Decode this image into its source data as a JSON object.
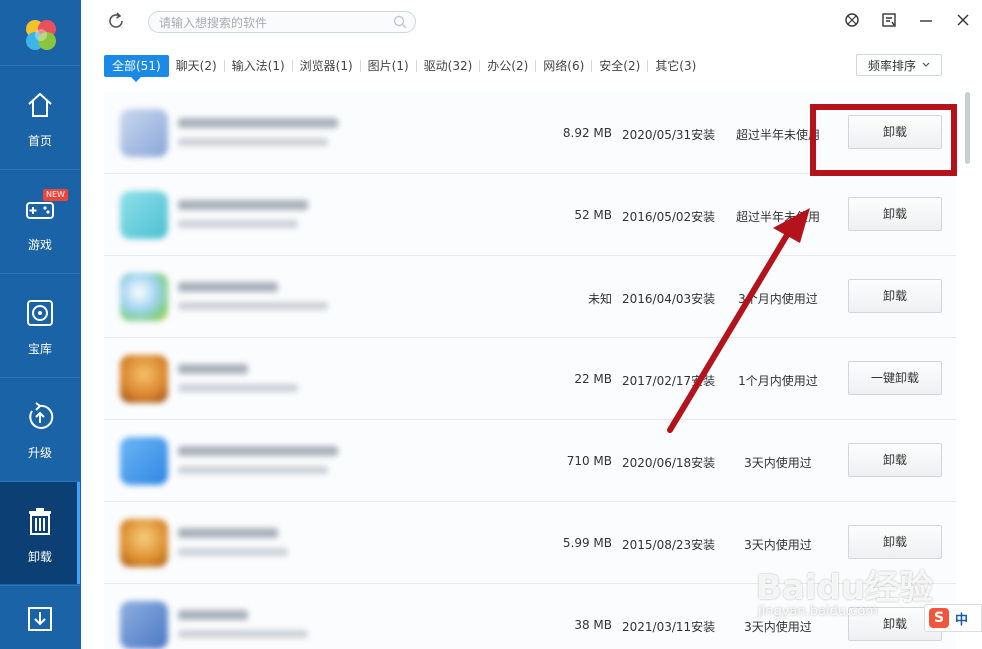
{
  "sidebar": {
    "items": [
      {
        "label": "首页",
        "icon": "home-icon"
      },
      {
        "label": "游戏",
        "icon": "gamepad-icon",
        "badge": "NEW"
      },
      {
        "label": "宝库",
        "icon": "disc-icon"
      },
      {
        "label": "升级",
        "icon": "upgrade-icon"
      },
      {
        "label": "卸载",
        "icon": "trash-icon",
        "active": true
      },
      {
        "label": "",
        "icon": "download-icon"
      }
    ]
  },
  "search": {
    "placeholder": "请输入想搜索的软件"
  },
  "tabs": [
    "全部(51)",
    "聊天(2)",
    "输入法(1)",
    "浏览器(1)",
    "图片(1)",
    "驱动(32)",
    "办公(2)",
    "网络(6)",
    "安全(2)",
    "其它(3)"
  ],
  "sort": {
    "label": "频率排序"
  },
  "apps": [
    {
      "size": "8.92 MB",
      "date": "2020/05/31安装",
      "usage": "超过半年未使用",
      "action": "卸载"
    },
    {
      "size": "52 MB",
      "date": "2016/05/02安装",
      "usage": "超过半年未使用",
      "action": "卸载"
    },
    {
      "size": "未知",
      "date": "2016/04/03安装",
      "usage": "3个月内使用过",
      "action": "卸载"
    },
    {
      "size": "22 MB",
      "date": "2017/02/17安装",
      "usage": "1个月内使用过",
      "action": "一键卸载"
    },
    {
      "size": "710 MB",
      "date": "2020/06/18安装",
      "usage": "3天内使用过",
      "action": "卸载"
    },
    {
      "size": "5.99 MB",
      "date": "2015/08/23安装",
      "usage": "3天内使用过",
      "action": "卸载"
    },
    {
      "size": "38 MB",
      "date": "2021/03/11安装",
      "usage": "3天内使用过",
      "action": "卸载"
    }
  ],
  "watermark": {
    "brand": "Baidu经验",
    "url": "jingyan.baidu.com"
  },
  "ime": {
    "logo": "S",
    "mode": "中"
  },
  "colors": {
    "sidebar": "#1b63a7",
    "sidebar_active": "#0c3f73",
    "tab_active": "#1b8ae6",
    "annotation": "#b4131b"
  }
}
